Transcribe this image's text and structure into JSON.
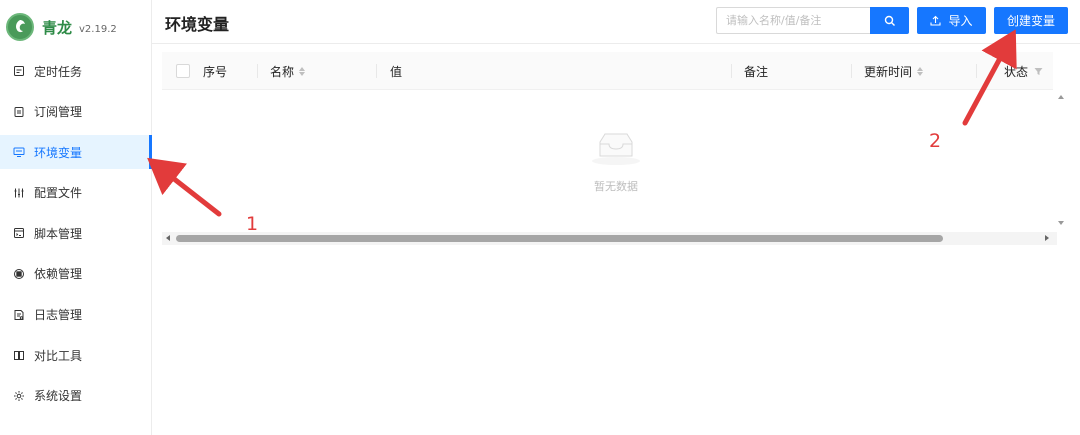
{
  "app": {
    "name": "青龙",
    "version": "v2.19.2"
  },
  "sidebar": {
    "items": [
      {
        "label": "定时任务",
        "icon": "calendar-icon",
        "active": false
      },
      {
        "label": "订阅管理",
        "icon": "subscription-icon",
        "active": false
      },
      {
        "label": "环境变量",
        "icon": "monitor-icon",
        "active": true
      },
      {
        "label": "配置文件",
        "icon": "sliders-icon",
        "active": false
      },
      {
        "label": "脚本管理",
        "icon": "code-icon",
        "active": false
      },
      {
        "label": "依赖管理",
        "icon": "package-icon",
        "active": false
      },
      {
        "label": "日志管理",
        "icon": "log-file-icon",
        "active": false
      },
      {
        "label": "对比工具",
        "icon": "compare-icon",
        "active": false
      },
      {
        "label": "系统设置",
        "icon": "settings-icon",
        "active": false
      }
    ]
  },
  "header": {
    "title": "环境变量",
    "search_placeholder": "请输入名称/值/备注",
    "search_value": "",
    "import_label": "导入",
    "create_label": "创建变量"
  },
  "table": {
    "columns": {
      "index": "序号",
      "name": "名称",
      "value": "值",
      "remarks": "备注",
      "updated": "更新时间",
      "status": "状态"
    },
    "rows": [],
    "empty_text": "暂无数据"
  },
  "annotations": {
    "step1": "1",
    "step2": "2"
  },
  "colors": {
    "primary": "#1677ff",
    "active_bg": "#e6f4ff",
    "annotation": "#e23b3b",
    "brand_green": "#2e8b47"
  }
}
